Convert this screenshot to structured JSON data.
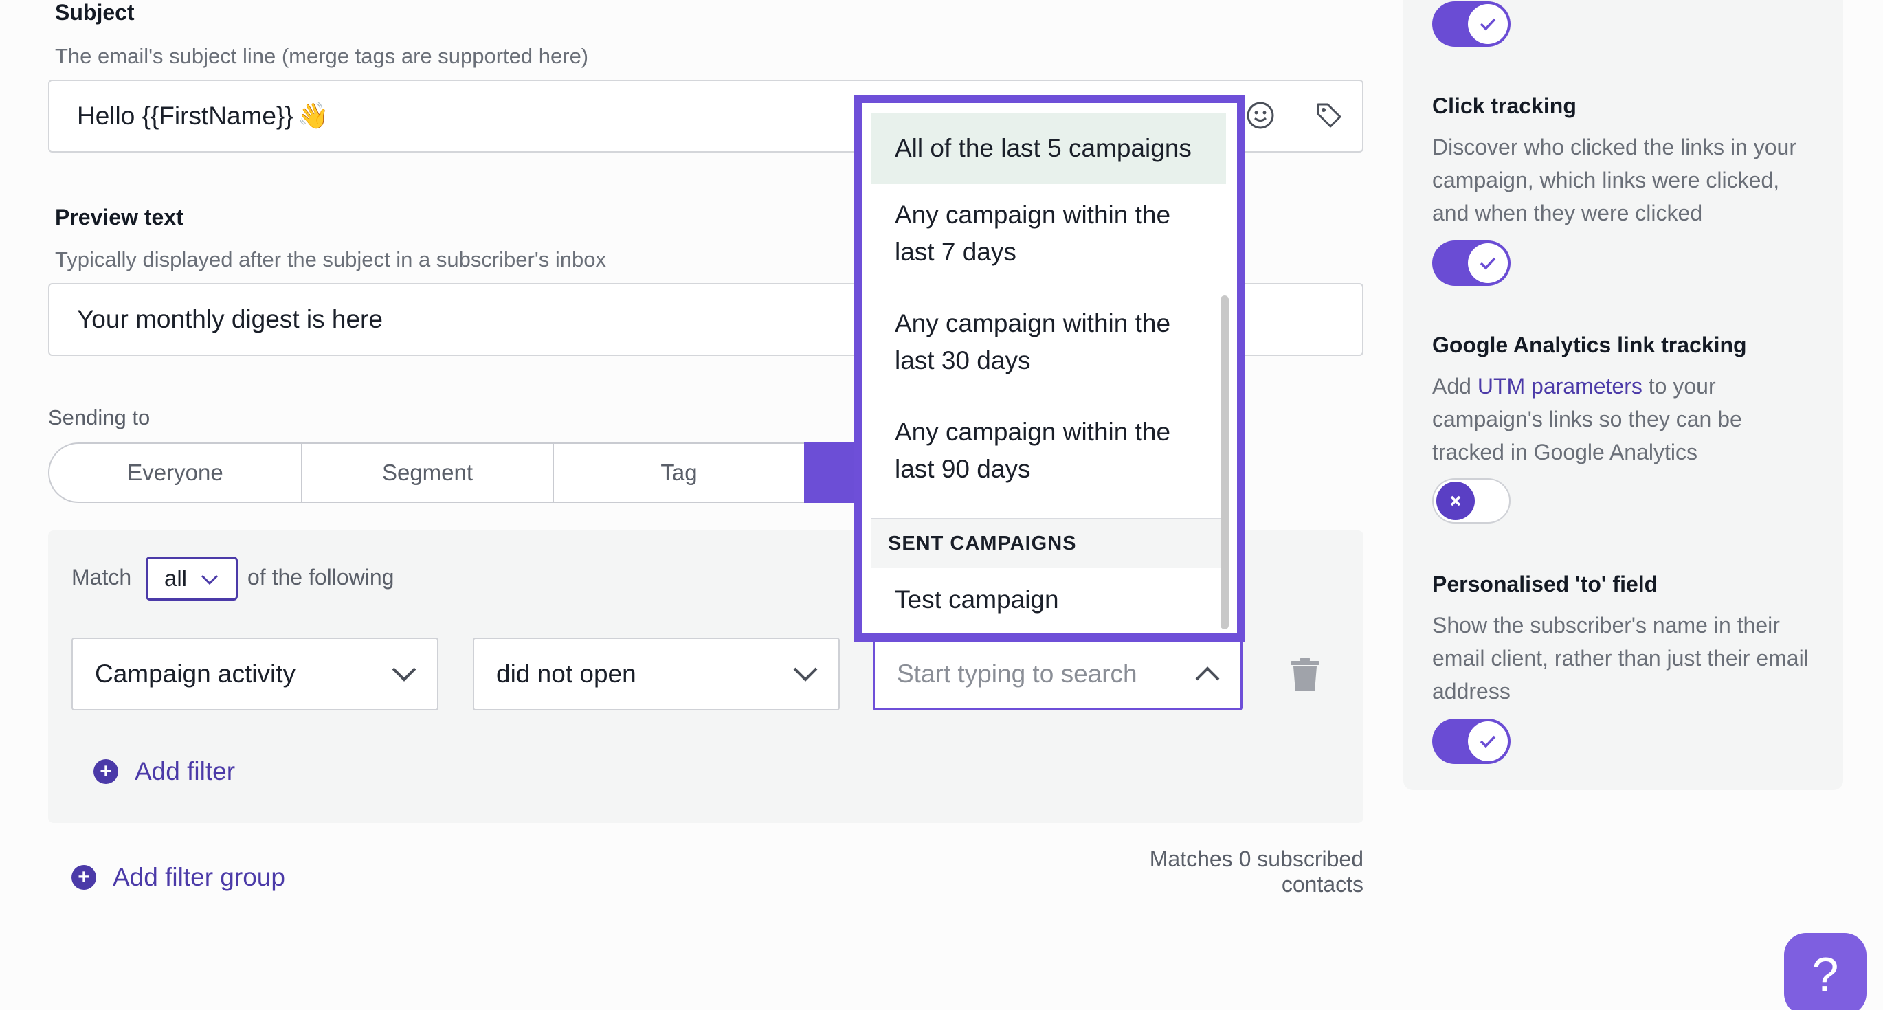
{
  "subject": {
    "label": "Subject",
    "help": "The email's subject line (merge tags are supported here)",
    "value": "Hello {{FirstName}}",
    "emoji": "👋"
  },
  "preview": {
    "label": "Preview text",
    "help": "Typically displayed after the subject in a subscriber's inbox",
    "value": "Your monthly digest is here"
  },
  "sending_to": {
    "label": "Sending to",
    "options": [
      "Everyone",
      "Segment",
      "Tag",
      ""
    ],
    "active_index": 3
  },
  "filters": {
    "match_prefix": "Match",
    "match_value": "all",
    "match_suffix": "of the following",
    "field": "Campaign activity",
    "operator": "did not open",
    "search_placeholder": "Start typing to search",
    "add_filter": "Add filter",
    "add_filter_group": "Add filter group",
    "matches": "Matches 0 subscribed contacts"
  },
  "dropdown": {
    "options": [
      {
        "line1": "All of the last 5 campaigns",
        "line2": ""
      },
      {
        "line1": "Any campaign within the",
        "line2": "last 7 days"
      },
      {
        "line1": "Any campaign within the",
        "line2": "last 30 days"
      },
      {
        "line1": "Any campaign within the",
        "line2": "last 90 days"
      }
    ],
    "section_header": "SENT CAMPAIGNS",
    "sent": [
      "Test campaign"
    ]
  },
  "settings": {
    "click_tracking": {
      "title": "Click tracking",
      "desc": "Discover who clicked the links in your campaign, which links were clicked, and when they were clicked",
      "enabled": true
    },
    "ga_tracking": {
      "title": "Google Analytics link tracking",
      "desc_prefix": "Add ",
      "desc_link": "UTM parameters",
      "desc_suffix": " to your campaign's links so they can be tracked in Google Analytics",
      "enabled": false
    },
    "personalised_to": {
      "title": "Personalised 'to' field",
      "desc": "Show the subscriber's name in their email client, rather than just their email address",
      "enabled": true
    },
    "top_toggle_enabled": true
  },
  "help_button": "?",
  "colors": {
    "accent": "#6c4ed6",
    "link": "#4b3aa8",
    "highlight": "#e8f1ec"
  },
  "icons": [
    "emoji-icon",
    "tag-icon",
    "chevron-down-icon",
    "chevron-up-icon",
    "trash-icon",
    "plus-circle-icon",
    "check-icon",
    "x-icon",
    "question-icon"
  ]
}
